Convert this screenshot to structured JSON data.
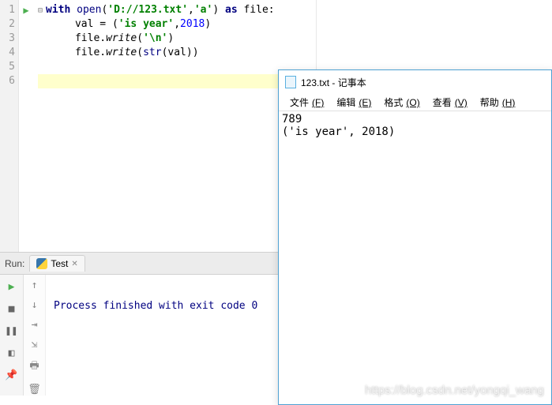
{
  "editor": {
    "lines": [
      {
        "n": "1"
      },
      {
        "n": "2"
      },
      {
        "n": "3"
      },
      {
        "n": "4"
      },
      {
        "n": "5"
      },
      {
        "n": "6"
      }
    ],
    "tok": {
      "with": "with",
      "open": "open",
      "lp": "(",
      "rp": ")",
      "path": "'D://123.txt'",
      "comma": ",",
      "mode": "'a'",
      "as": "as",
      "file": "file",
      "colon": ":",
      "val": "val",
      "eq": " = ",
      "tuple_open": "(",
      "isyear": "'is year'",
      "num": "2018",
      "tuple_close": ")",
      "dot": ".",
      "write": "write",
      "nl": "'\\n'",
      "str": "str",
      "valp": "(val)"
    },
    "current_line_indent": "    "
  },
  "run": {
    "panel_label": "Run:",
    "tab_name": "Test",
    "output": "Process finished with exit code 0"
  },
  "notepad": {
    "title": "123.txt - 记事本",
    "menu": {
      "file": "文件",
      "file_k": "(F)",
      "edit": "编辑",
      "edit_k": "(E)",
      "format": "格式",
      "format_k": "(O)",
      "view": "查看",
      "view_k": "(V)",
      "help": "帮助",
      "help_k": "(H)"
    },
    "content_l1": "789",
    "content_l2": "('is year', 2018)"
  },
  "watermark": "https://blog.csdn.net/yongqi_wang"
}
